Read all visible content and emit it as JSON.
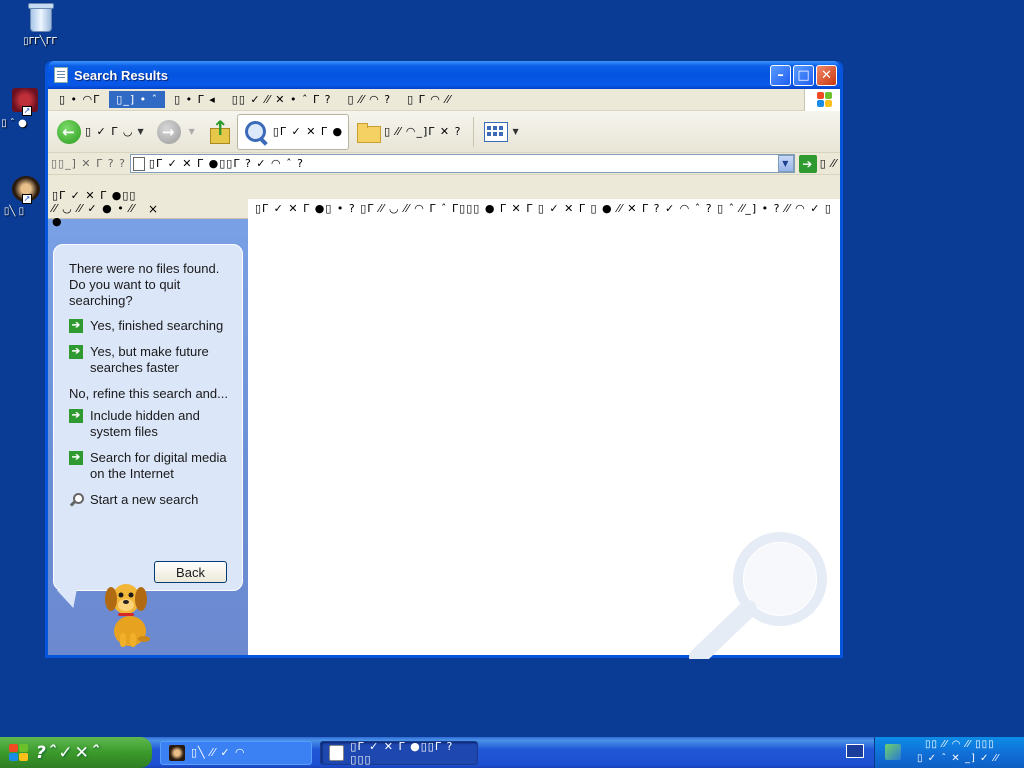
{
  "desktop": {
    "icons": [
      {
        "label": "▯ΓΓ╲ΓΓ",
        "icon": "recycle-bin-icon"
      },
      {
        "label": "▯ ˆ ●",
        "icon": "application-icon"
      },
      {
        "label": "▯╲ ▯",
        "icon": "photo-icon"
      }
    ]
  },
  "window": {
    "title": "Search Results",
    "menu": [
      "▯ • ◠Γ",
      "▯_] • ˆ",
      "▯ • Γ ◂",
      "▯▯ ✓ ⁄⁄ ✕ • ˆ Γ ?",
      "▯ ⁄⁄ ◠ ?",
      "▯ Γ ◠ ⁄⁄"
    ],
    "menu_active_index": 1,
    "toolbar": {
      "back_label": "▯ ✓ Γ ◡",
      "search_label": "▯Γ ✓ ✕ Γ ●",
      "folders_label": "▯ ⁄⁄ ◠_]Γ ✕ ?"
    },
    "address": {
      "label": "▯▯_] ✕ Γ ? ?",
      "value": "▯Γ ✓ ✕ Γ ●▯▯Γ ? ✓ ◠ ˆ ?",
      "go_label": "▯ ⁄⁄"
    },
    "search_pane": {
      "header": "▯Γ ✓ ✕ Γ ●▯▯ ⁄⁄ ◡ ⁄⁄ ✓ ● • ⁄⁄ ●",
      "close": "×",
      "question": "There were no files found.  Do you want to quit searching?",
      "options": [
        "Yes, finished searching",
        "Yes, but make future searches faster"
      ],
      "refine_label": "No, refine this search and...",
      "refine_options": [
        "Include hidden and system files",
        "Search for digital media on the Internet"
      ],
      "new_search": "Start a new search",
      "back_button": "Back"
    },
    "results_message": "▯Γ ✓ ✕ Γ ●▯ • ? ▯Γ ⁄⁄ ◡ ⁄⁄ ◠ Γ ˆ Γ▯▯▯ ● Γ ✕ Γ ▯ ✓ ✕ Γ ▯ ● ⁄⁄ ✕ Γ ? ✓ ◠ ˆ ? ▯ ˆ ⁄⁄_] • ? ⁄⁄ ◠ ✓ ▯"
  },
  "taskbar": {
    "start_label": "?ˆ✓✕ˆ",
    "tasks": [
      {
        "label": "▯╲ ⁄⁄ ✓ ◠",
        "active": false
      },
      {
        "label": "▯Γ ✓ ✕ Γ ●▯▯Γ ?▯▯▯",
        "active": true
      }
    ],
    "tray": {
      "line1": "▯▯ ⁄⁄ ◠ ⁄⁄ ▯▯▯",
      "line2": "▯ ✓ ˆ ✕ _] ✓ ⁄⁄"
    }
  },
  "colors": {
    "desktop": "#0a3c96",
    "title_bar": "#0453e0",
    "accent": "#316ac5",
    "start_button": "#3c9a2c",
    "pane_bg": "#6a8fd6"
  }
}
